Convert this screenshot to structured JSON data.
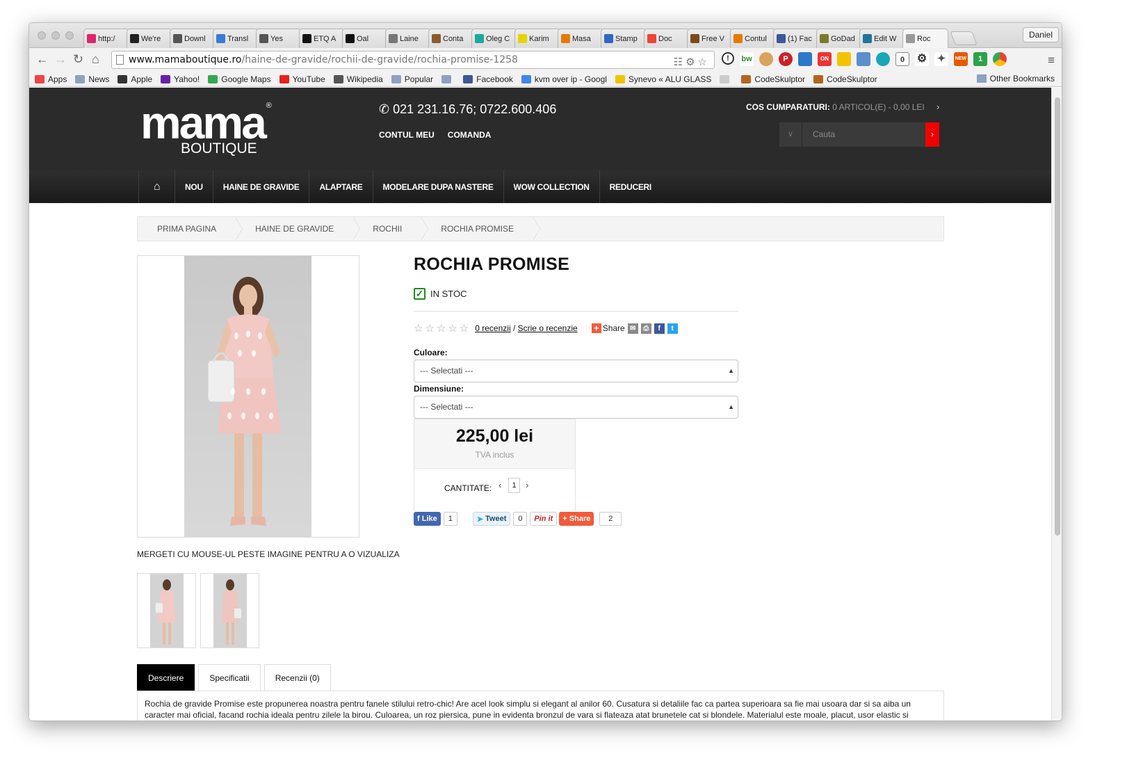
{
  "browser": {
    "tabs": [
      {
        "label": "http:/",
        "color": "#e0246b"
      },
      {
        "label": "We're",
        "color": "#222"
      },
      {
        "label": "Downl",
        "color": "#555"
      },
      {
        "label": "Transl",
        "color": "#3a7bd5"
      },
      {
        "label": "Yes",
        "color": "#555"
      },
      {
        "label": "ETQ A",
        "color": "#111"
      },
      {
        "label": "Oal",
        "color": "#111"
      },
      {
        "label": "Laine",
        "color": "#777"
      },
      {
        "label": "Conta",
        "color": "#8a5a2b"
      },
      {
        "label": "Oleg C",
        "color": "#1aaa9a"
      },
      {
        "label": "Karim",
        "color": "#e6d400"
      },
      {
        "label": "Masa",
        "color": "#e57a00"
      },
      {
        "label": "Stamp",
        "color": "#2f67c4"
      },
      {
        "label": "Doc",
        "color": "#e43"
      },
      {
        "label": "Free V",
        "color": "#7a4b1a"
      },
      {
        "label": "Contul",
        "color": "#e57a00"
      },
      {
        "label": "(1) Fac",
        "color": "#3b5998"
      },
      {
        "label": "GoDad",
        "color": "#7a7a2a"
      },
      {
        "label": "Edit W",
        "color": "#21759b"
      },
      {
        "label": "Roc",
        "color": "#999"
      }
    ],
    "profile": "Daniel",
    "url_host": "www.mamaboutique.ro",
    "url_path": "/haine-de-gravide/rochii-de-gravide/rochia-promise-1258",
    "bookmarks": [
      "Apps",
      "News",
      "Apple",
      "Yahoo!",
      "Google Maps",
      "YouTube",
      "Wikipedia",
      "Popular",
      "",
      "Facebook",
      "kvm over ip - Googl",
      "Synevo « ALU GLASS",
      "",
      "CodeSkulptor",
      "CodeSkulptor"
    ],
    "other_bookmarks": "Other Bookmarks"
  },
  "header": {
    "logo_main": "mama",
    "logo_sub": "BOUTIQUE",
    "logo_reg": "®",
    "phone": "021 231.16.76; 0722.600.406",
    "account_links": [
      "CONTUL MEU",
      "COMANDA"
    ],
    "cart_label": "COS CUMPARATURI:",
    "cart_value": "0 ARTICOL(E) - 0,00 LEI",
    "search_placeholder": "Cauta"
  },
  "nav": {
    "items": [
      "NOU",
      "HAINE DE GRAVIDE",
      "ALAPTARE",
      "MODELARE DUPA NASTERE",
      "WOW COLLECTION",
      "REDUCERI"
    ]
  },
  "breadcrumb": [
    "PRIMA PAGINA",
    "HAINE DE GRAVIDE",
    "ROCHII",
    "ROCHIA PROMISE"
  ],
  "product": {
    "title": "ROCHIA PROMISE",
    "stock": "IN STOC",
    "rating": 0,
    "reviews_link": "0 recenzii",
    "separator": "/",
    "write_review": "Scrie o recenzie",
    "share_label": "Share",
    "color_label": "Culoare:",
    "color_value": "--- Selectati ---",
    "size_label": "Dimensiune:",
    "size_value": "--- Selectati ---",
    "price": "225,00 lei",
    "vat": "TVA inclus",
    "quantity_label": "CANTITATE:",
    "quantity": "1",
    "hover_note": "MERGETI CU MOUSE-UL PESTE IMAGINE PENTRU A O VIZUALIZA"
  },
  "social": {
    "like_label": "Like",
    "like_count": "1",
    "tweet_label": "Tweet",
    "tweet_count": "0",
    "pin_label": "Pin it",
    "share_label": "Share",
    "share_count": "2"
  },
  "tabs": {
    "items": [
      "Descriere",
      "Specificatii",
      "Recenzii (0)"
    ],
    "active": 0,
    "description": "Rochia de gravide Promise este propunerea noastra pentru fanele stilului retro-chic! Are acel look simplu si elegant al anilor 60. Cusatura si detaliile fac ca partea superioara sa fie mai usoara dar si sa aiba un caracter mai oficial, facand rochia ideala pentru zilele la birou. Culoarea, un roz piersica, pune in evidenta bronzul de vara si flateaza atat brunetele cat si blondele. Materialul este moale, placut, usor elastic si ascunde micile imperfectiuni ale siluetei."
  },
  "colors": {
    "header_bg": "#2b2b2b",
    "accent_red": "#e00000",
    "stock_green": "#1e8d1e",
    "dress_pink": "#f2c9c4"
  }
}
